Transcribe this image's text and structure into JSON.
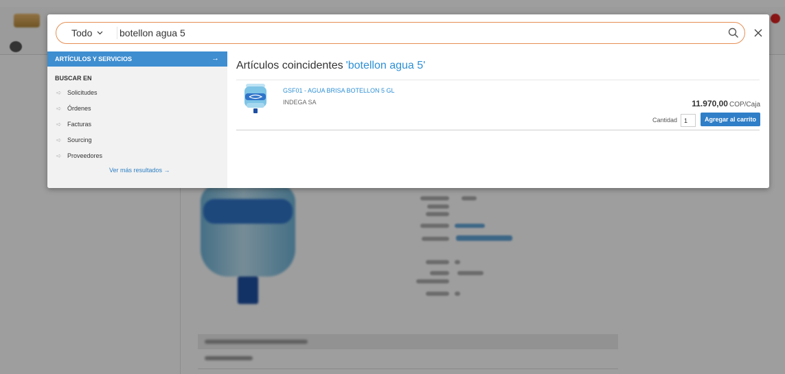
{
  "search": {
    "scope_label": "Todo",
    "query": "botellon agua 5"
  },
  "left_panel": {
    "header_label": "ARTÍCULOS Y SERVICIOS",
    "header_arrow": "→",
    "section_title": "BUSCAR EN",
    "items": [
      {
        "label": "Solicitudes"
      },
      {
        "label": "Órdenes"
      },
      {
        "label": "Facturas"
      },
      {
        "label": "Sourcing"
      },
      {
        "label": "Proveedores"
      }
    ],
    "more_label": "Ver más resultados →"
  },
  "results": {
    "title": "Artículos coincidentes",
    "query_display": "'botellon agua 5'",
    "product": {
      "name": "GSF01 - AGUA BRISA BOTELLON 5 GL",
      "vendor": "INDEGA SA",
      "price": "11.970,00",
      "price_unit": "COP/Caja",
      "quantity_label": "Cantidad",
      "quantity_value": "1",
      "add_to_cart_label": "Agregar al carrito"
    }
  },
  "icons": {
    "search": "search-icon",
    "close": "close-icon",
    "chevron": "chevron-down-icon",
    "item_arrow": "arrow-right-icon"
  },
  "colors": {
    "accent_blue": "#3e8ed0",
    "link_blue": "#2d8fd5",
    "search_border": "#e58e53",
    "button_blue": "#2f7ec7"
  }
}
